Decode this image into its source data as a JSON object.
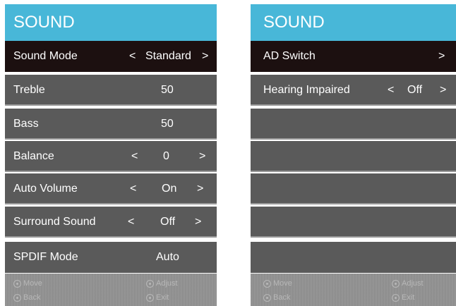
{
  "left_panel": {
    "title": "SOUND",
    "rows": [
      {
        "label": "Sound Mode",
        "value": "Standard",
        "left_arrow": "<",
        "right_arrow": ">",
        "selected": true
      },
      {
        "label": "Treble",
        "value": "50"
      },
      {
        "label": "Bass",
        "value": "50"
      },
      {
        "label": "Balance",
        "value": "0",
        "left_arrow": "<",
        "right_arrow": ">"
      },
      {
        "label": "Auto Volume",
        "value": "On",
        "left_arrow": "<",
        "right_arrow": ">"
      },
      {
        "label": "Surround Sound",
        "value": "Off",
        "left_arrow": "<",
        "right_arrow": ">"
      },
      {
        "label": "SPDIF Mode",
        "value": "Auto"
      }
    ],
    "footer": {
      "move": "Move",
      "adjust": "Adjust",
      "back": "Back",
      "exit": "Exit"
    }
  },
  "right_panel": {
    "title": "SOUND",
    "rows": [
      {
        "label": "AD Switch",
        "right_arrow": ">",
        "selected": true
      },
      {
        "label": "Hearing Impaired",
        "value": "Off",
        "left_arrow": "<",
        "right_arrow": ">"
      }
    ],
    "footer": {
      "move": "Move",
      "adjust": "Adjust",
      "back": "Back",
      "exit": "Exit"
    }
  },
  "colors": {
    "header": "#48b7d8",
    "row": "#5a5a5a",
    "selected_row": "#1c1010"
  }
}
